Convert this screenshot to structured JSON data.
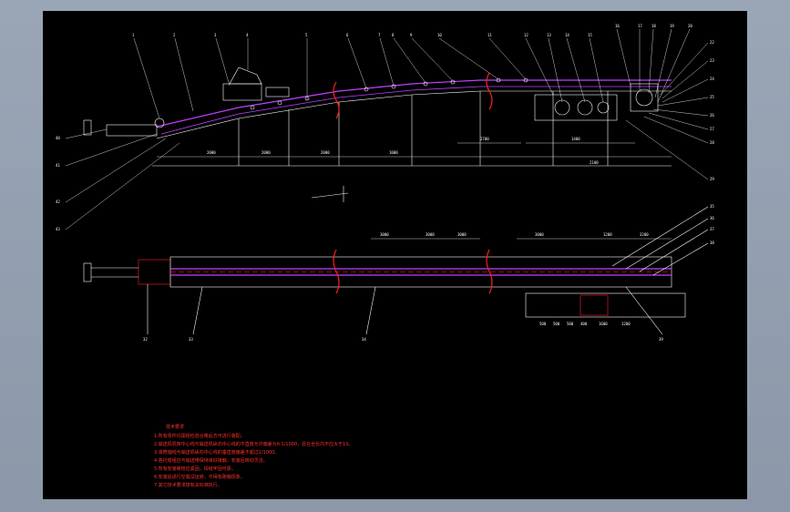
{
  "drawing": {
    "frame_color": "#000000",
    "line_color": "#ffffff",
    "belt_color": "#c040ff",
    "accent_color": "#ff2020",
    "callouts_top": [
      "1",
      "2",
      "3",
      "4",
      "5",
      "6",
      "7",
      "8",
      "9",
      "10",
      "11",
      "12",
      "13",
      "14",
      "15",
      "16",
      "17",
      "18",
      "19",
      "20"
    ],
    "callouts_right": [
      "22",
      "23",
      "24",
      "25",
      "26",
      "27",
      "28",
      "29"
    ],
    "callouts_left": [
      "40",
      "41",
      "42",
      "43"
    ],
    "callouts_plan": [
      "32",
      "33",
      "34",
      "35",
      "36",
      "37",
      "38",
      "39"
    ],
    "dims_side": [
      "2000",
      "2000",
      "2000",
      "1000",
      "2700",
      "1400",
      "2100"
    ],
    "dims_plan": [
      "3000",
      "3000",
      "3000",
      "3000",
      "1200",
      "3200"
    ],
    "dims_bottom": [
      "500",
      "500",
      "500",
      "400",
      "1600",
      "1200"
    ],
    "notes_title": "技术要求",
    "notes": [
      "1.所有零件均需经检验合格后方可进行装配。",
      "2.输送机机架中心线与输送机纵向中心线的不直度允许偏差为0.1/1000，且在全长内不应大于10。",
      "3.滚筒轴线与输送机纵向中心线的垂直度偏差不超过2/1000。",
      "4.各托辊组应与输送带保持良好接触，安装后转动灵活。",
      "5.所有安装螺栓应紧固，焊缝牢固可靠。",
      "6.安装后进行空载试运转，不得有跑偏现象。",
      "7.其它技术要求按有关标准执行。"
    ]
  }
}
